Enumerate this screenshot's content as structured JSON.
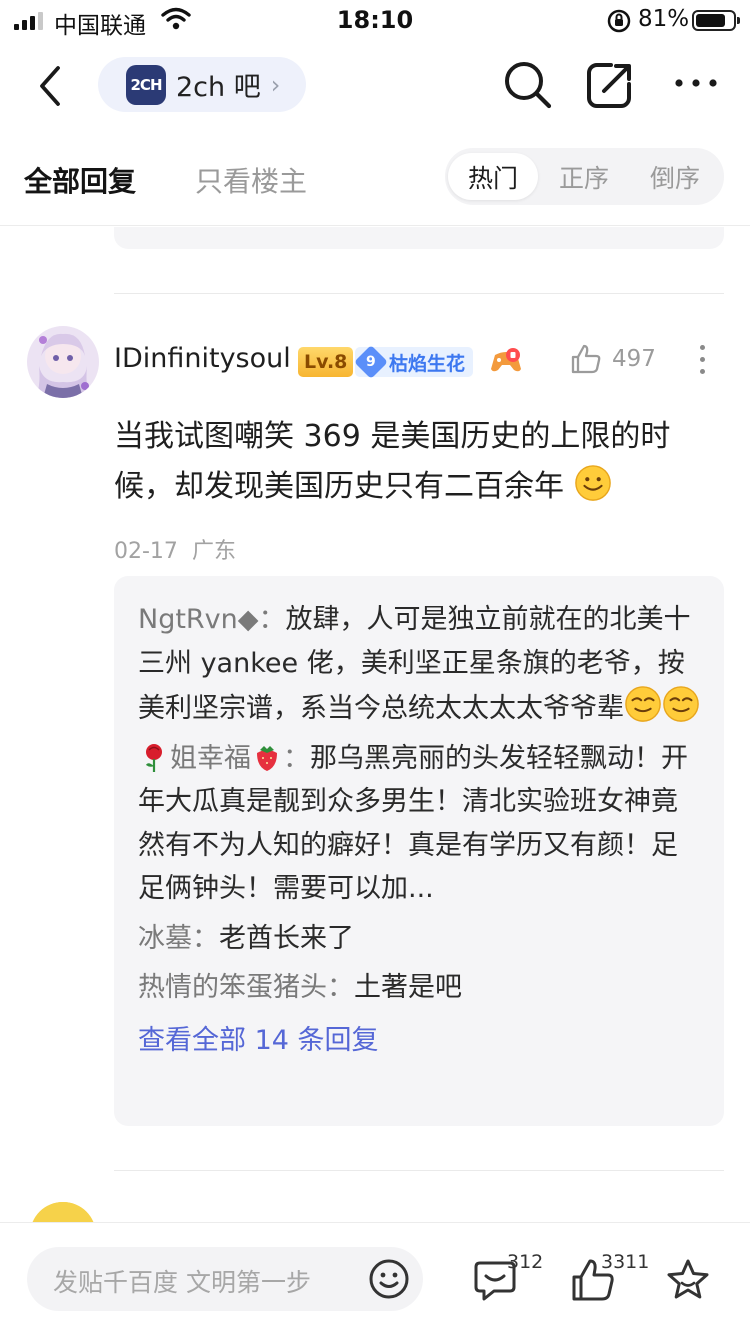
{
  "status": {
    "carrier": "中国联通",
    "time": "18:10",
    "battery": "81%",
    "battery_level": 0.81
  },
  "nav": {
    "forum_logo": "2CH",
    "forum_name": "2ch 吧"
  },
  "tabs": {
    "all": "全部回复",
    "op_only": "只看楼主",
    "sort": [
      "热门",
      "正序",
      "倒序"
    ],
    "sort_active": "热门"
  },
  "post": {
    "username": "IDinfinitysoul",
    "level": "Lv.8",
    "fan_level": "9",
    "fan_name": "枯焰生花",
    "likes": "497",
    "text": "当我试图嘲笑 369 是美国历史的上限的时候，却发现美国历史只有二百余年",
    "date": "02-17",
    "location": "广东",
    "replies": [
      {
        "name": "NgtRvn◆",
        "sep": "：",
        "text": "放肆，人可是独立前就在的北美十三州 yankee 佬，美利坚正星条旗的老爷，按美利坚宗谱，系当今总统太太太太爷爷辈"
      },
      {
        "name": "姐幸福",
        "sep": "：",
        "text": "那乌黑亮丽的头发轻轻飘动！开年大瓜真是靓到众多男生！清北实验班女神竟然有不为人知的癖好！真是有学历又有颜！足足俩钟头！需要可以加..."
      },
      {
        "name": "冰墓",
        "sep": "：",
        "text": "老酋长来了"
      },
      {
        "name": "热情的笨蛋猪头",
        "sep": "：",
        "text": "土著是吧"
      }
    ],
    "view_all": "查看全部 14 条回复"
  },
  "bottom": {
    "placeholder": "发贴千百度 文明第一步",
    "comment_count": "312",
    "like_count": "3311"
  }
}
